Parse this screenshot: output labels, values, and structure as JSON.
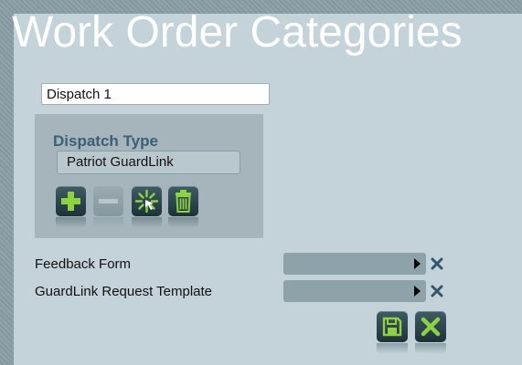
{
  "page": {
    "title": "Work Order Categories"
  },
  "name_field": {
    "value": "Dispatch 1"
  },
  "dispatch": {
    "label": "Dispatch Type",
    "selected": "Patriot GuardLink",
    "buttons": [
      {
        "icon": "plus-icon",
        "enabled": true
      },
      {
        "icon": "minus-icon",
        "enabled": false
      },
      {
        "icon": "sparkle-icon",
        "enabled": true
      },
      {
        "icon": "trash-icon",
        "enabled": true
      }
    ]
  },
  "fields": [
    {
      "label": "Feedback Form",
      "value": ""
    },
    {
      "label": "GuardLink Request Template",
      "value": ""
    }
  ],
  "actions": {
    "save_icon": "save-icon",
    "cancel_icon": "cancel-icon"
  },
  "colors": {
    "accent_green": "#8ed33f",
    "title_blue": "#3c5f7a",
    "button_dark": "#24404a",
    "clear_x": "#35566b"
  }
}
